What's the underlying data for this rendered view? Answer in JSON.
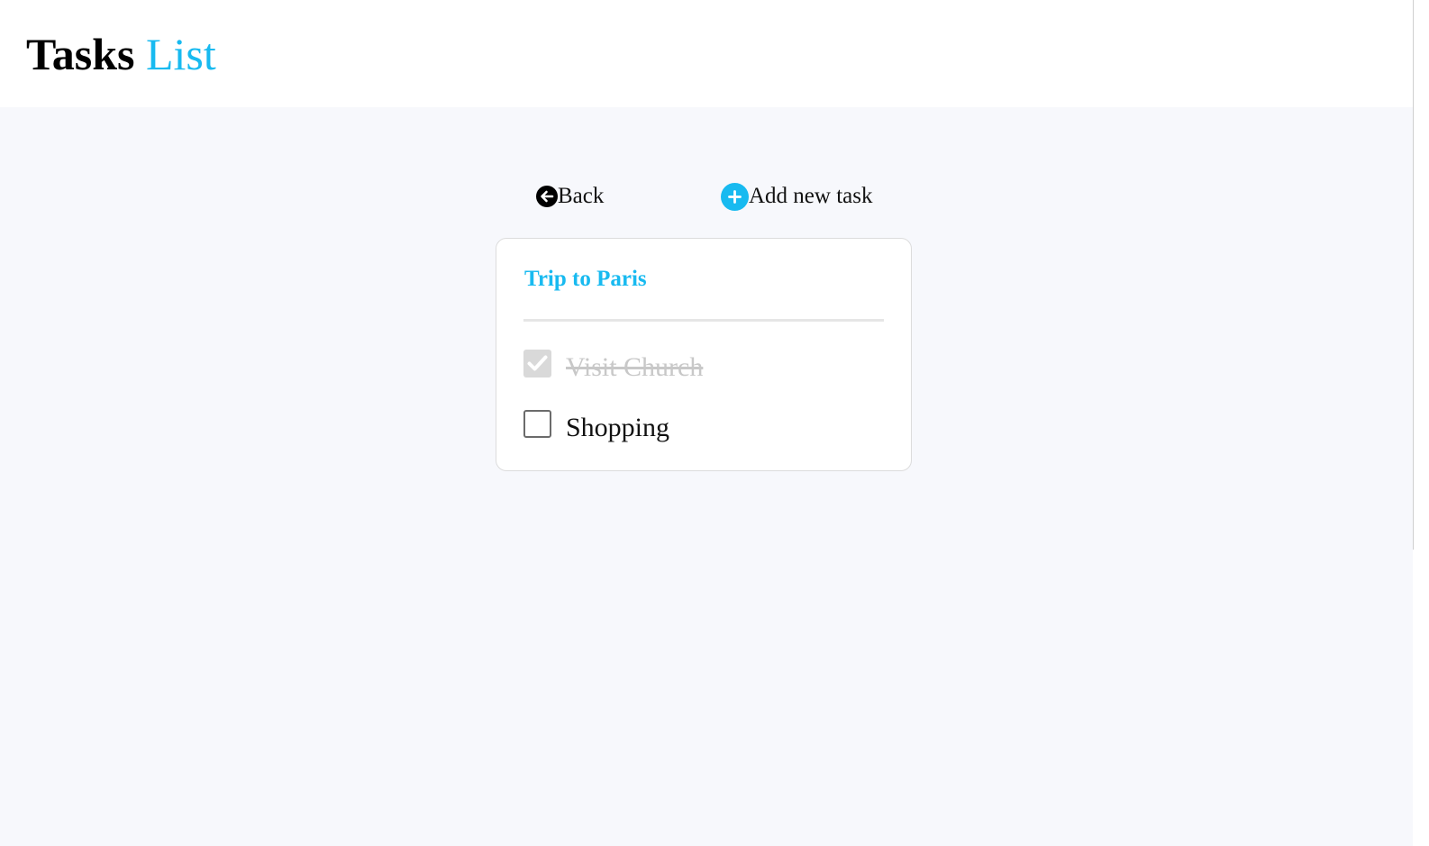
{
  "header": {
    "title_main": "Tasks",
    "title_accent": "List"
  },
  "nav": {
    "back_label": "Back",
    "add_label": "Add new task",
    "back_icon": "arrow-left-circle-icon",
    "add_icon": "plus-circle-icon"
  },
  "list": {
    "title": "Trip to Paris",
    "tasks": [
      {
        "label": "Visit Church",
        "completed": true
      },
      {
        "label": "Shopping",
        "completed": false
      }
    ]
  },
  "colors": {
    "accent": "#18baf0",
    "text": "#111111",
    "completed_text": "#c8c8c8",
    "page_background": "#f7f8fc",
    "card_background": "#ffffff"
  }
}
